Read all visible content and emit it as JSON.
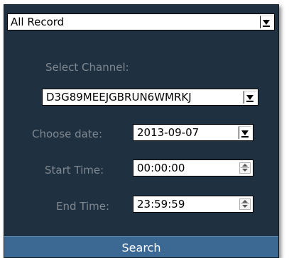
{
  "record_type": {
    "selected": "All Record",
    "arrow_icon": "chevron-down-icon"
  },
  "channel": {
    "label": "Select Channel:",
    "selected": "D3G89MEEJGBRUN6WMRKJ"
  },
  "date": {
    "label": "Choose date:",
    "value": "2013-09-07"
  },
  "start_time": {
    "label": "Start Time:",
    "value": "00:00:00"
  },
  "end_time": {
    "label": "End Time:",
    "value": "23:59:59"
  },
  "search": {
    "label": "Search"
  },
  "colors": {
    "panel_bg": "#1f3040",
    "label_gray": "#7f8890",
    "button_blue": "#3b6994"
  }
}
